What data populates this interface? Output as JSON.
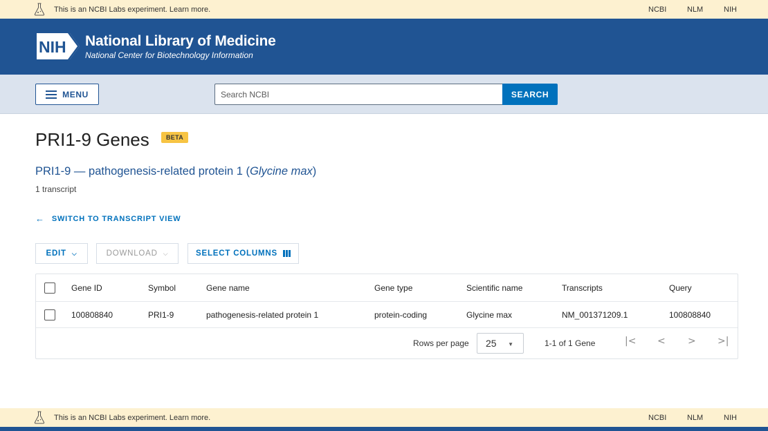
{
  "labs_banner": {
    "text": "This is an NCBI Labs experiment. Learn more.",
    "links": [
      "NCBI",
      "NLM",
      "NIH"
    ]
  },
  "masthead": {
    "logo_text": "NIH",
    "title": "National Library of Medicine",
    "subtitle": "National Center for Biotechnology Information"
  },
  "search": {
    "menu_label": "MENU",
    "placeholder": "Search NCBI",
    "button_label": "SEARCH"
  },
  "page": {
    "title": "PRI1-9 Genes",
    "badge": "BETA",
    "gene_link_prefix": "PRI1-9 — pathogenesis-related protein 1 (",
    "gene_link_organism": "Glycine max",
    "gene_link_suffix": ")",
    "transcript_count": "1 transcript",
    "switch_view_label": "SWITCH TO TRANSCRIPT VIEW"
  },
  "toolbar": {
    "edit_label": "EDIT",
    "download_label": "DOWNLOAD",
    "select_columns_label": "SELECT COLUMNS"
  },
  "table": {
    "columns": [
      "Gene ID",
      "Symbol",
      "Gene name",
      "Gene type",
      "Scientific name",
      "Transcripts",
      "Query"
    ],
    "rows": [
      [
        "100808840",
        "PRI1-9",
        "pathogenesis-related protein 1",
        "protein-coding",
        "Glycine max",
        "NM_001371209.1",
        "100808840"
      ]
    ]
  },
  "pagination": {
    "rows_per_page_label": "Rows per page",
    "rows_per_page": "25",
    "range": "1-1 of 1 Gene"
  },
  "colors": {
    "labs_bg": "#fdf1d0",
    "masthead": "#205493",
    "search_band": "#dbe3ee",
    "primary": "#0071bc",
    "badge": "#f7c443"
  },
  "icons": [
    "flask-icon",
    "nih-logo",
    "hamburger-icon",
    "arrow-left-icon",
    "chevron-down-icon",
    "columns-icon",
    "first-page-icon",
    "prev-page-icon",
    "next-page-icon",
    "last-page-icon"
  ]
}
